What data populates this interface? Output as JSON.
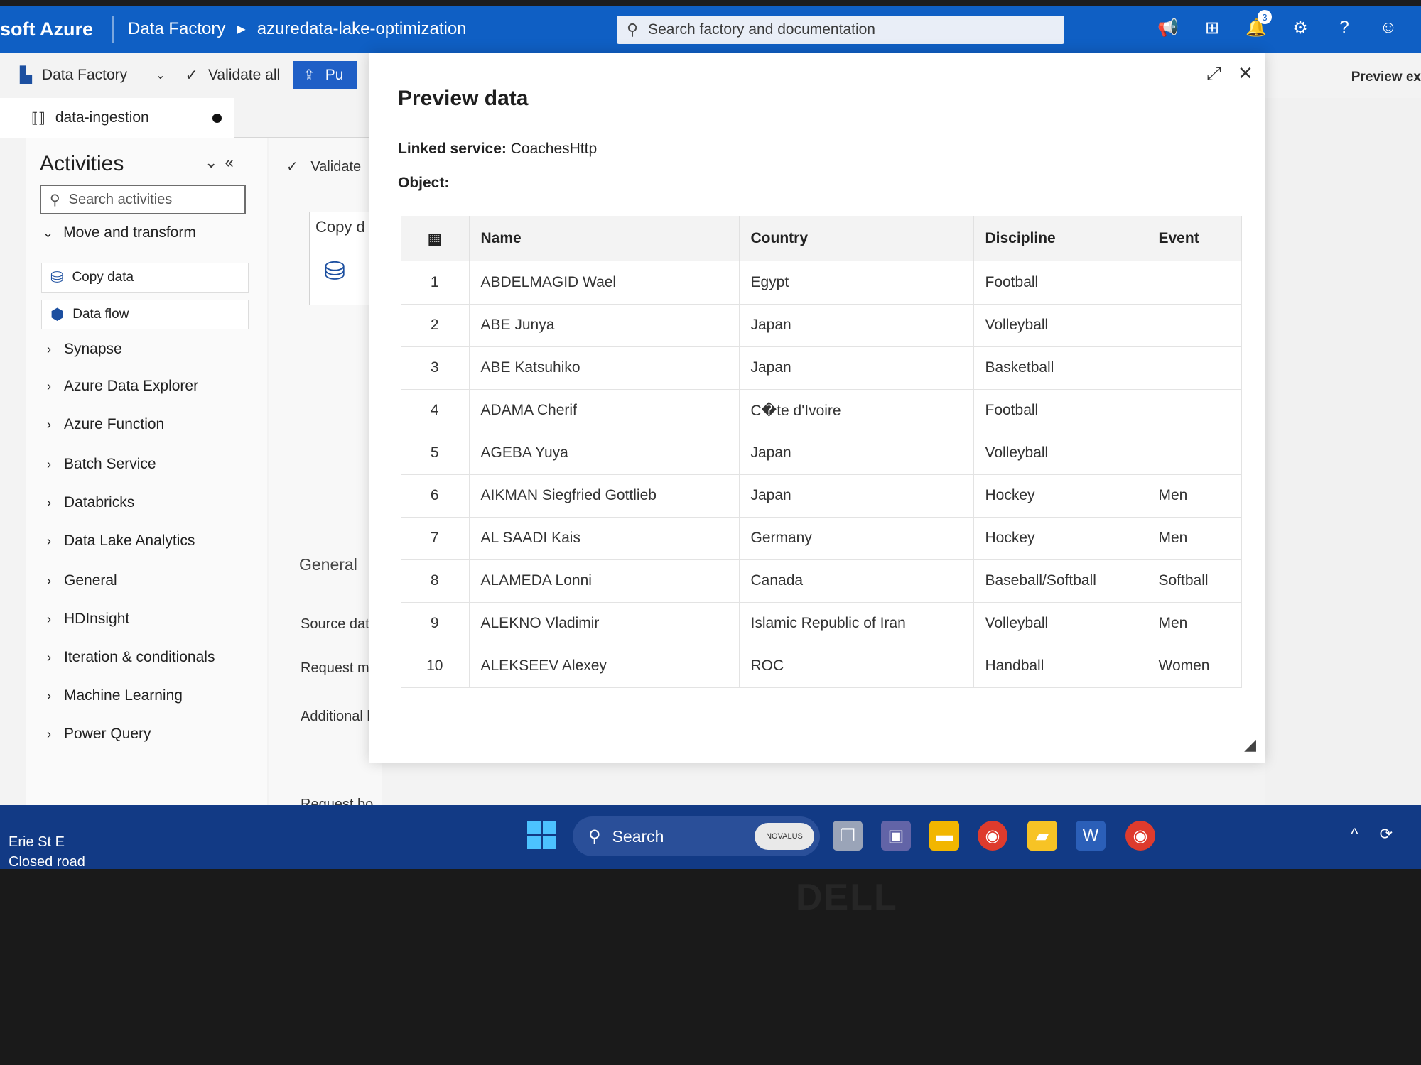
{
  "topbar": {
    "brand": "soft Azure",
    "crumb1": "Data Factory",
    "crumb2": "azuredata-lake-optimization",
    "search_placeholder": "Search factory and documentation",
    "notifications_count": "3"
  },
  "toolbar": {
    "factory_label": "Data Factory",
    "validate_all": "Validate all",
    "publish": "Pu",
    "preview_ex": "Preview ex"
  },
  "tab": {
    "label": "data-ingestion"
  },
  "activities": {
    "title": "Activities",
    "search_placeholder": "Search activities",
    "group": "Move and transform",
    "cards": [
      "Copy data",
      "Data flow"
    ],
    "categories": [
      "Synapse",
      "Azure Data Explorer",
      "Azure Function",
      "Batch Service",
      "Databricks",
      "Data Lake Analytics",
      "General",
      "HDInsight",
      "Iteration & conditionals",
      "Machine Learning",
      "Power Query"
    ]
  },
  "canvas": {
    "validate": "Validate",
    "copy_node": "Copy d",
    "general_tab": "General",
    "props": [
      "Source data",
      "Request me",
      "Additional h",
      "Request bo"
    ]
  },
  "dialog": {
    "title": "Preview data",
    "linked_service_label": "Linked service:",
    "linked_service_value": "CoachesHttp",
    "object_label": "Object:",
    "columns": [
      "Name",
      "Country",
      "Discipline",
      "Event"
    ],
    "rows": [
      [
        "1",
        "ABDELMAGID Wael",
        "Egypt",
        "Football",
        ""
      ],
      [
        "2",
        "ABE Junya",
        "Japan",
        "Volleyball",
        ""
      ],
      [
        "3",
        "ABE Katsuhiko",
        "Japan",
        "Basketball",
        ""
      ],
      [
        "4",
        "ADAMA Cherif",
        "C�te d'Ivoire",
        "Football",
        ""
      ],
      [
        "5",
        "AGEBA Yuya",
        "Japan",
        "Volleyball",
        ""
      ],
      [
        "6",
        "AIKMAN Siegfried Gottlieb",
        "Japan",
        "Hockey",
        "Men"
      ],
      [
        "7",
        "AL SAADI Kais",
        "Germany",
        "Hockey",
        "Men"
      ],
      [
        "8",
        "ALAMEDA Lonni",
        "Canada",
        "Baseball/Softball",
        "Softball"
      ],
      [
        "9",
        "ALEKNO Vladimir",
        "Islamic Republic of Iran",
        "Volleyball",
        "Men"
      ],
      [
        "10",
        "ALEKSEEV Alexey",
        "ROC",
        "Handball",
        "Women"
      ]
    ]
  },
  "taskbar": {
    "weather_line1": "Erie St E",
    "weather_line2": "Closed road",
    "search": "Search",
    "novalus": "NOVALUS"
  },
  "bezel": {
    "brand": "DELL"
  }
}
